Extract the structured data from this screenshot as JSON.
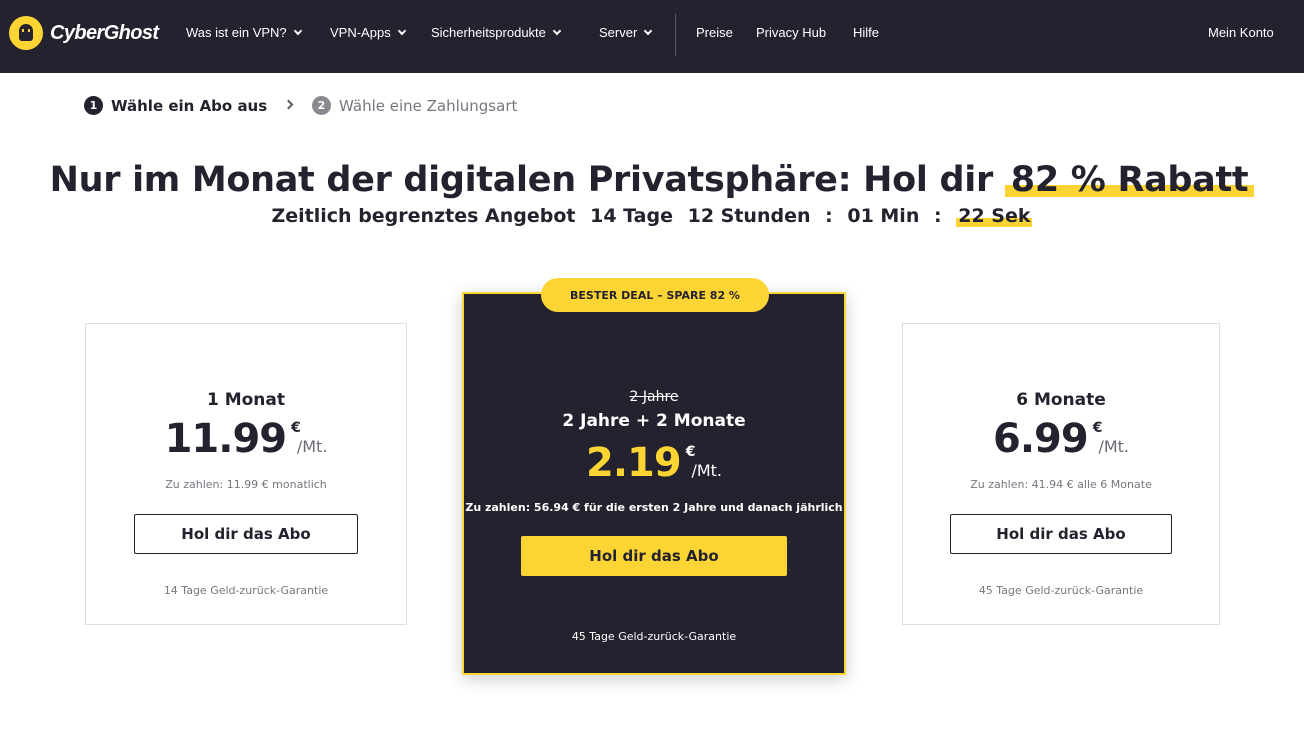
{
  "nav": {
    "logo_text": "CyberGhost",
    "items": [
      {
        "label": "Was ist ein VPN?"
      },
      {
        "label": "VPN-Apps"
      },
      {
        "label": "Sicherheitsprodukte"
      },
      {
        "label": "Server"
      },
      {
        "label": "Preise"
      },
      {
        "label": "Privacy Hub"
      },
      {
        "label": "Hilfe"
      }
    ],
    "account": "Mein Konto"
  },
  "steps": [
    {
      "num": "1",
      "label": "Wähle ein Abo aus"
    },
    {
      "num": "2",
      "label": "Wähle eine Zahlungsart"
    }
  ],
  "headline": {
    "text": "Nur im Monat der digitalen Privatsphäre: Hol dir",
    "highlight": "82 % Rabatt"
  },
  "countdown": {
    "label": "Zeitlich begrenztes Angebot",
    "days": "14 Tage",
    "hours": "12 Stunden",
    "minutes": "01 Min",
    "seconds": "22 Sek",
    "sep": ":"
  },
  "plans": {
    "left": {
      "name": "1 Monat",
      "price": "11.99",
      "currency": "€",
      "per": "/Mt.",
      "pay_note": "Zu zahlen: 11.99 € monatlich",
      "button": "Hol dir das Abo",
      "guarantee": "14 Tage Geld-zurück-Garantie"
    },
    "middle": {
      "badge": "BESTER DEAL – SPARE 82 %",
      "old_name": "2 Jahre",
      "name": "2 Jahre + 2 Monate",
      "price": "2.19",
      "currency": "€",
      "per": "/Mt.",
      "pay_note": "Zu zahlen: 56.94 € für die ersten 2 Jahre und danach jährlich",
      "button": "Hol dir das Abo",
      "guarantee": "45 Tage Geld-zurück-Garantie"
    },
    "right": {
      "name": "6 Monate",
      "price": "6.99",
      "currency": "€",
      "per": "/Mt.",
      "pay_note": "Zu zahlen: 41.94 € alle 6 Monate",
      "button": "Hol dir das Abo",
      "guarantee": "45 Tage Geld-zurück-Garantie"
    }
  },
  "colors": {
    "brand_yellow": "#fcd434",
    "dark": "#23222e"
  }
}
